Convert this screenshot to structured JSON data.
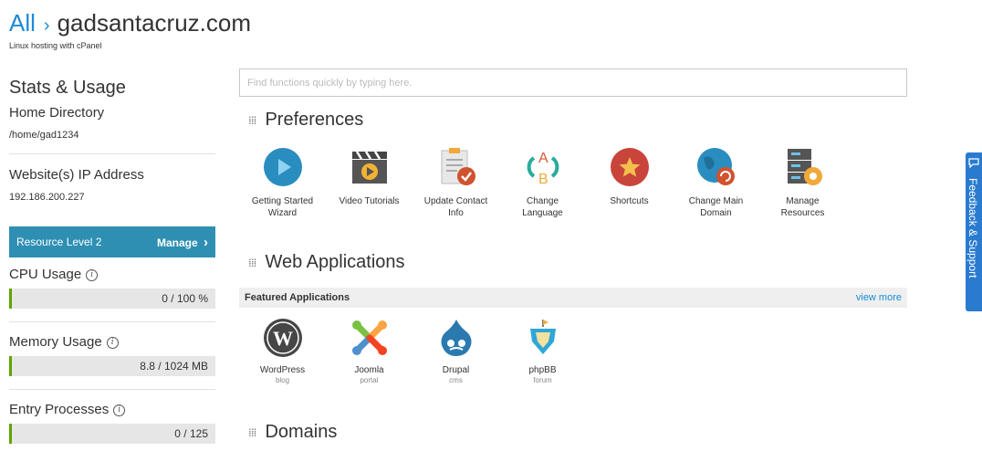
{
  "header": {
    "breadcrumb_root": "All",
    "breadcrumb_sep": "›",
    "domain": "gadsantacruz.com",
    "subtitle": "Linux hosting with cPanel"
  },
  "sidebar": {
    "title": "Stats & Usage",
    "home_dir_label": "Home Directory",
    "home_dir_value": "/home/gad1234",
    "ip_label": "Website(s) IP Address",
    "ip_value": "192.186.200.227",
    "resource_level": "Resource Level 2",
    "manage_label": "Manage",
    "manage_arrow": "›",
    "metrics": [
      {
        "label": "CPU Usage",
        "value": "0 / 100 %",
        "fraction": 0.0
      },
      {
        "label": "Memory Usage",
        "value": "8.8 / 1024 MB",
        "fraction": 0.009
      },
      {
        "label": "Entry Processes",
        "value": "0 / 125",
        "fraction": 0.0
      }
    ],
    "info_glyph": "i"
  },
  "search": {
    "placeholder": "Find functions quickly by typing here."
  },
  "sections": {
    "grip": "⁞⁞⁞",
    "preferences": "Preferences",
    "web_applications": "Web Applications",
    "domains": "Domains"
  },
  "preferences": [
    {
      "label1": "Getting Started",
      "label2": "Wizard",
      "icon": "play-circle-icon"
    },
    {
      "label1": "Video Tutorials",
      "label2": "",
      "icon": "clapperboard-icon"
    },
    {
      "label1": "Update Contact",
      "label2": "Info",
      "icon": "clipboard-check-icon"
    },
    {
      "label1": "Change",
      "label2": "Language",
      "icon": "language-ab-icon"
    },
    {
      "label1": "Shortcuts",
      "label2": "",
      "icon": "star-circle-icon"
    },
    {
      "label1": "Change Main",
      "label2": "Domain",
      "icon": "globe-refresh-icon"
    },
    {
      "label1": "Manage",
      "label2": "Resources",
      "icon": "server-gear-icon"
    }
  ],
  "featured": {
    "title": "Featured Applications",
    "view_more": "view more",
    "apps": [
      {
        "name": "WordPress",
        "sub": "blog",
        "icon": "wordpress-icon"
      },
      {
        "name": "Joomla",
        "sub": "portal",
        "icon": "joomla-icon"
      },
      {
        "name": "Drupal",
        "sub": "cms",
        "icon": "drupal-icon"
      },
      {
        "name": "phpBB",
        "sub": "forum",
        "icon": "phpbb-icon"
      }
    ]
  },
  "feedback": {
    "label": "Feedback & Support"
  },
  "colors": {
    "link": "#1a8bd6",
    "resource_bar": "#2e8fb3",
    "usage_fill": "#5fa600",
    "feedback_tab": "#2a7bd0"
  }
}
